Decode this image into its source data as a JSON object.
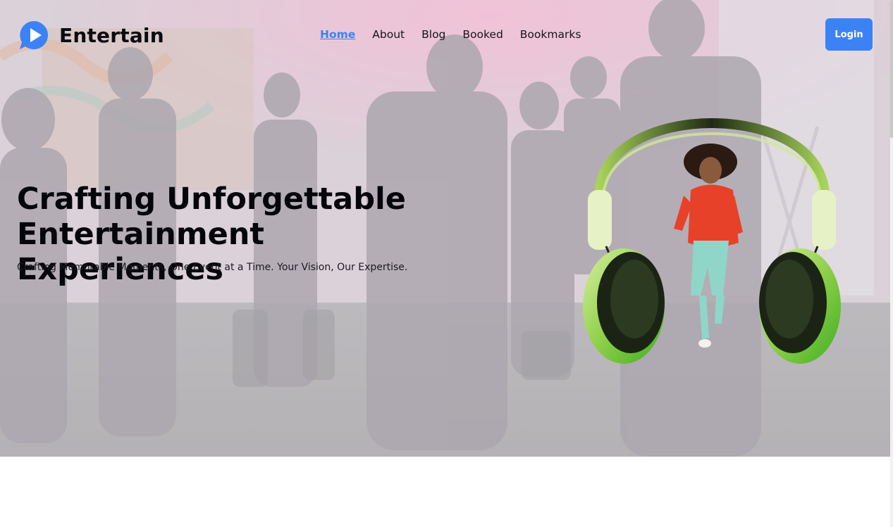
{
  "brand": {
    "name": "Entertain",
    "accent": "#3b82f6"
  },
  "nav": {
    "items": [
      {
        "label": "Home",
        "active": true
      },
      {
        "label": "About"
      },
      {
        "label": "Blog"
      },
      {
        "label": "Booked"
      },
      {
        "label": "Bookmarks"
      }
    ]
  },
  "actions": {
    "login_label": "Login"
  },
  "hero": {
    "title_line1": "Crafting Unforgettable",
    "title_line2": "Entertainment Experiences",
    "subtitle": "Crafting Memorable Moments, One Event at a Time. Your Vision, Our Expertise."
  },
  "icons": {
    "logo": "play-chat-bubble-icon"
  }
}
